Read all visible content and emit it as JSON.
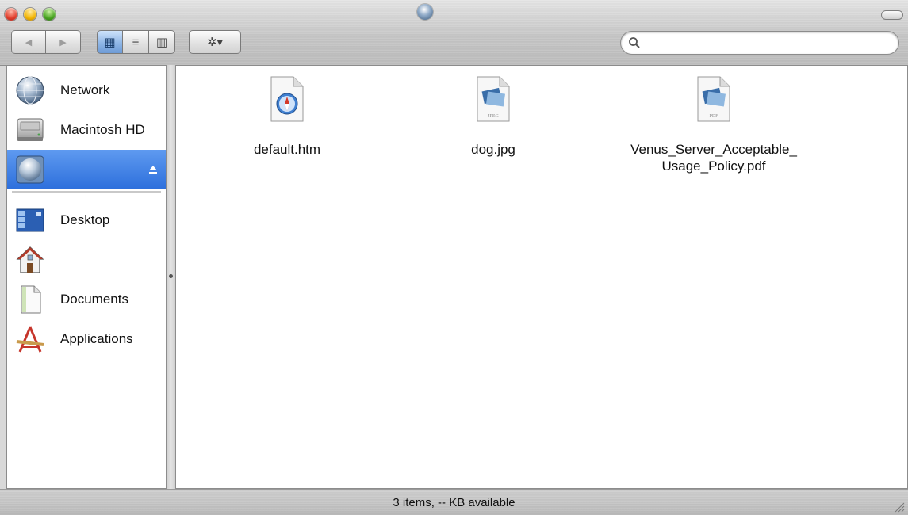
{
  "toolbar": {
    "back_glyph": "◀",
    "forward_glyph": "▶",
    "view_icon_glyph": "▦",
    "view_list_glyph": "≡",
    "view_columns_glyph": "▥",
    "action_glyph": "✲▾",
    "search_placeholder": ""
  },
  "sidebar": {
    "items": [
      {
        "label": "Network",
        "icon": "network-globe-icon"
      },
      {
        "label": "Macintosh HD",
        "icon": "hard-drive-icon"
      },
      {
        "label": "",
        "icon": "network-volume-icon",
        "selected": true,
        "eject": "eject-icon"
      },
      {
        "label": "Desktop",
        "icon": "desktop-icon"
      },
      {
        "label": "",
        "icon": "home-icon"
      },
      {
        "label": "Documents",
        "icon": "documents-icon"
      },
      {
        "label": "Applications",
        "icon": "applications-icon"
      }
    ]
  },
  "files": [
    {
      "name": "default.htm",
      "icon": "safari-document-icon"
    },
    {
      "name": "dog.jpg",
      "icon": "jpeg-document-icon",
      "badge": "JPEG"
    },
    {
      "name": "Venus_Server_Acceptable_\nUsage_Policy.pdf",
      "icon": "pdf-document-icon",
      "badge": "PDF"
    }
  ],
  "status": {
    "text": "3 items, -- KB available"
  },
  "colors": {
    "selection": "#2d6fdc",
    "window_metal": "#c4c4c4"
  }
}
